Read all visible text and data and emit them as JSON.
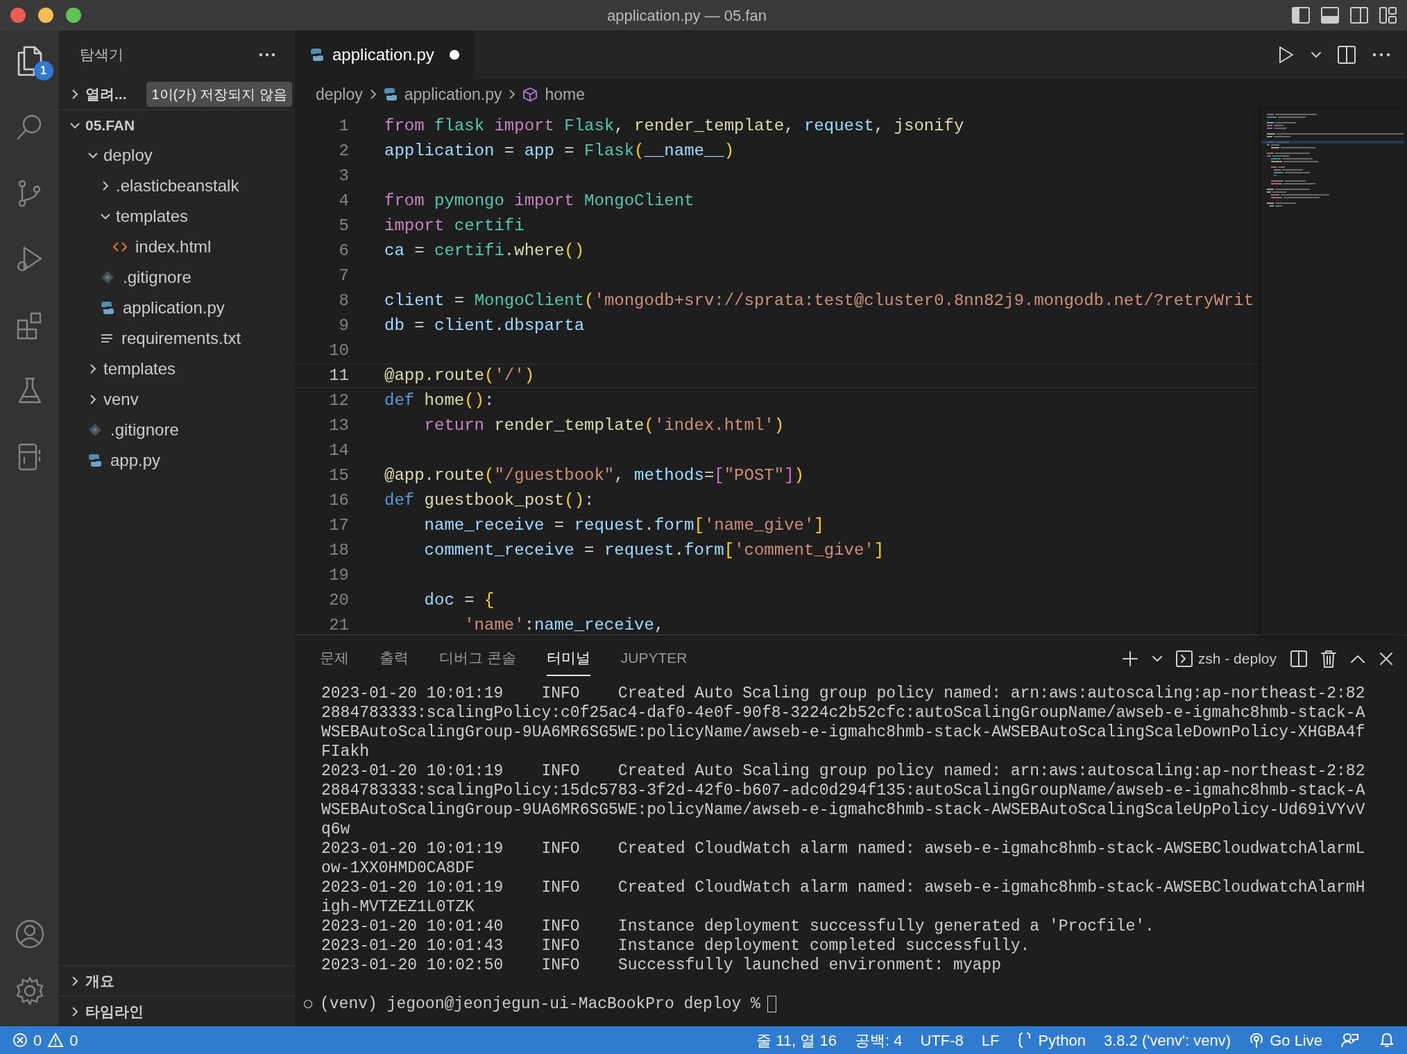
{
  "window": {
    "title": "application.py — 05.fan"
  },
  "activity_bar": {
    "badge": "1"
  },
  "explorer": {
    "title": "탐색기"
  },
  "open_editors": {
    "label": "열려...",
    "expanded": false,
    "badge": "1이(가) 저장되지 않음"
  },
  "folder": {
    "label": "05.FAN",
    "expanded": true,
    "children": [
      {
        "label": "deploy",
        "kind": "folder",
        "expanded": true,
        "children": [
          {
            "label": ".elasticbeanstalk",
            "kind": "folder",
            "expanded": false
          },
          {
            "label": "templates",
            "kind": "folder",
            "expanded": true,
            "children": [
              {
                "label": "index.html",
                "kind": "html"
              }
            ]
          },
          {
            "label": ".gitignore",
            "kind": "git"
          },
          {
            "label": "application.py",
            "kind": "python"
          },
          {
            "label": "requirements.txt",
            "kind": "text"
          }
        ]
      },
      {
        "label": "templates",
        "kind": "folder",
        "expanded": false
      },
      {
        "label": "venv",
        "kind": "folder",
        "expanded": false
      },
      {
        "label": ".gitignore",
        "kind": "git"
      },
      {
        "label": "app.py",
        "kind": "python"
      }
    ]
  },
  "bottom_sections": [
    {
      "label": "개요",
      "expanded": false
    },
    {
      "label": "타임라인",
      "expanded": false
    }
  ],
  "tabs": [
    {
      "label": "application.py",
      "kind": "python",
      "selected": true,
      "modified": true
    }
  ],
  "breadcrumb": [
    {
      "label": "deploy",
      "kind": "folder"
    },
    {
      "label": "application.py",
      "kind": "python"
    },
    {
      "label": "home",
      "kind": "symbol"
    }
  ],
  "code_lines": [
    {
      "number": "1",
      "current": false,
      "tokens": [
        {
          "kind": "kw",
          "text": "from "
        },
        {
          "kind": "cls",
          "text": "flask "
        },
        {
          "kind": "kw",
          "text": "import "
        },
        {
          "kind": "cls",
          "text": "Flask"
        },
        {
          "kind": "plain",
          "text": ", "
        },
        {
          "kind": "fn",
          "text": "render_template"
        },
        {
          "kind": "plain",
          "text": ", "
        },
        {
          "kind": "var",
          "text": "request"
        },
        {
          "kind": "plain",
          "text": ", "
        },
        {
          "kind": "fn",
          "text": "jsonify"
        }
      ]
    },
    {
      "number": "2",
      "current": false,
      "tokens": [
        {
          "kind": "var",
          "text": "application"
        },
        {
          "kind": "plain",
          "text": " = "
        },
        {
          "kind": "var",
          "text": "app"
        },
        {
          "kind": "plain",
          "text": " = "
        },
        {
          "kind": "cls",
          "text": "Flask"
        },
        {
          "kind": "b1",
          "text": "("
        },
        {
          "kind": "var",
          "text": "__name__"
        },
        {
          "kind": "b1",
          "text": ")"
        }
      ]
    },
    {
      "number": "3",
      "current": false
    },
    {
      "number": "4",
      "current": false,
      "tokens": [
        {
          "kind": "kw",
          "text": "from "
        },
        {
          "kind": "cls",
          "text": "pymongo "
        },
        {
          "kind": "kw",
          "text": "import "
        },
        {
          "kind": "cls",
          "text": "MongoClient"
        }
      ]
    },
    {
      "number": "5",
      "current": false,
      "tokens": [
        {
          "kind": "kw",
          "text": "import "
        },
        {
          "kind": "cls",
          "text": "certifi"
        }
      ]
    },
    {
      "number": "6",
      "current": false,
      "tokens": [
        {
          "kind": "var",
          "text": "ca"
        },
        {
          "kind": "plain",
          "text": " = "
        },
        {
          "kind": "cls",
          "text": "certifi"
        },
        {
          "kind": "plain",
          "text": "."
        },
        {
          "kind": "fn",
          "text": "where"
        },
        {
          "kind": "b1",
          "text": "()"
        }
      ]
    },
    {
      "number": "7",
      "current": false
    },
    {
      "number": "8",
      "current": false,
      "tokens": [
        {
          "kind": "var",
          "text": "client"
        },
        {
          "kind": "plain",
          "text": " = "
        },
        {
          "kind": "cls",
          "text": "MongoClient"
        },
        {
          "kind": "b1",
          "text": "("
        },
        {
          "kind": "str",
          "text": "'mongodb+srv://sprata:test@cluster0.8nn82j9.mongodb.net/?retryWrit"
        }
      ]
    },
    {
      "number": "9",
      "current": false,
      "tokens": [
        {
          "kind": "var",
          "text": "db"
        },
        {
          "kind": "plain",
          "text": " = "
        },
        {
          "kind": "var",
          "text": "client"
        },
        {
          "kind": "plain",
          "text": "."
        },
        {
          "kind": "var",
          "text": "dbsparta"
        }
      ]
    },
    {
      "number": "10",
      "current": false
    },
    {
      "number": "11",
      "current": true,
      "tokens": [
        {
          "kind": "fn",
          "text": "@app.route"
        },
        {
          "kind": "b1",
          "text": "("
        },
        {
          "kind": "str",
          "text": "'/'"
        },
        {
          "kind": "b1",
          "text": ")"
        }
      ]
    },
    {
      "number": "12",
      "current": false,
      "tokens": [
        {
          "kind": "def",
          "text": "def "
        },
        {
          "kind": "fn",
          "text": "home"
        },
        {
          "kind": "b1",
          "text": "()"
        },
        {
          "kind": "plain",
          "text": ":"
        }
      ]
    },
    {
      "number": "13",
      "current": false,
      "tokens": [
        {
          "kind": "kw",
          "text": "    return "
        },
        {
          "kind": "fn",
          "text": "render_template"
        },
        {
          "kind": "b1",
          "text": "("
        },
        {
          "kind": "str",
          "text": "'index.html'"
        },
        {
          "kind": "b1",
          "text": ")"
        }
      ]
    },
    {
      "number": "14",
      "current": false
    },
    {
      "number": "15",
      "current": false,
      "tokens": [
        {
          "kind": "fn",
          "text": "@app.route"
        },
        {
          "kind": "b1",
          "text": "("
        },
        {
          "kind": "str",
          "text": "\"/guestbook\""
        },
        {
          "kind": "plain",
          "text": ", "
        },
        {
          "kind": "var",
          "text": "methods"
        },
        {
          "kind": "plain",
          "text": "="
        },
        {
          "kind": "b2",
          "text": "["
        },
        {
          "kind": "str",
          "text": "\"POST\""
        },
        {
          "kind": "b2",
          "text": "]"
        },
        {
          "kind": "b1",
          "text": ")"
        }
      ]
    },
    {
      "number": "16",
      "current": false,
      "tokens": [
        {
          "kind": "def",
          "text": "def "
        },
        {
          "kind": "fn",
          "text": "guestbook_post"
        },
        {
          "kind": "b1",
          "text": "()"
        },
        {
          "kind": "plain",
          "text": ":"
        }
      ]
    },
    {
      "number": "17",
      "current": false,
      "tokens": [
        {
          "kind": "var",
          "text": "    name_receive"
        },
        {
          "kind": "plain",
          "text": " = "
        },
        {
          "kind": "var",
          "text": "request"
        },
        {
          "kind": "plain",
          "text": "."
        },
        {
          "kind": "var",
          "text": "form"
        },
        {
          "kind": "b1",
          "text": "["
        },
        {
          "kind": "str",
          "text": "'name_give'"
        },
        {
          "kind": "b1",
          "text": "]"
        }
      ]
    },
    {
      "number": "18",
      "current": false,
      "tokens": [
        {
          "kind": "var",
          "text": "    comment_receive"
        },
        {
          "kind": "plain",
          "text": " = "
        },
        {
          "kind": "var",
          "text": "request"
        },
        {
          "kind": "plain",
          "text": "."
        },
        {
          "kind": "var",
          "text": "form"
        },
        {
          "kind": "b1",
          "text": "["
        },
        {
          "kind": "str",
          "text": "'comment_give'"
        },
        {
          "kind": "b1",
          "text": "]"
        }
      ]
    },
    {
      "number": "19",
      "current": false
    },
    {
      "number": "20",
      "current": false,
      "tokens": [
        {
          "kind": "var",
          "text": "    doc"
        },
        {
          "kind": "plain",
          "text": " = "
        },
        {
          "kind": "b1",
          "text": "{"
        }
      ]
    },
    {
      "number": "21",
      "current": false,
      "tokens": [
        {
          "kind": "str",
          "text": "        'name'"
        },
        {
          "kind": "plain",
          "text": ":"
        },
        {
          "kind": "var",
          "text": "name_receive"
        },
        {
          "kind": "plain",
          "text": ","
        }
      ]
    }
  ],
  "panel": {
    "tabs": [
      {
        "label": "문제",
        "selected": false
      },
      {
        "label": "출력",
        "selected": false
      },
      {
        "label": "디버그 콘솔",
        "selected": false
      },
      {
        "label": "터미널",
        "selected": true
      },
      {
        "label": "JUPYTER",
        "selected": false
      }
    ],
    "terminal_name": "zsh - deploy",
    "lines": [
      "2023-01-20 10:01:19    INFO    Created Auto Scaling group policy named: arn:aws:autoscaling:ap-northeast-2:82",
      "2884783333:scalingPolicy:c0f25ac4-daf0-4e0f-90f8-3224c2b52cfc:autoScalingGroupName/awseb-e-igmahc8hmb-stack-A",
      "WSEBAutoScalingGroup-9UA6MR6SG5WE:policyName/awseb-e-igmahc8hmb-stack-AWSEBAutoScalingScaleDownPolicy-XHGBA4f",
      "FIakh",
      "2023-01-20 10:01:19    INFO    Created Auto Scaling group policy named: arn:aws:autoscaling:ap-northeast-2:82",
      "2884783333:scalingPolicy:15dc5783-3f2d-42f0-b607-adc0d294f135:autoScalingGroupName/awseb-e-igmahc8hmb-stack-A",
      "WSEBAutoScalingGroup-9UA6MR6SG5WE:policyName/awseb-e-igmahc8hmb-stack-AWSEBAutoScalingScaleUpPolicy-Ud69iVYvV",
      "q6w",
      "2023-01-20 10:01:19    INFO    Created CloudWatch alarm named: awseb-e-igmahc8hmb-stack-AWSEBCloudwatchAlarmL",
      "ow-1XX0HMD0CA8DF",
      "2023-01-20 10:01:19    INFO    Created CloudWatch alarm named: awseb-e-igmahc8hmb-stack-AWSEBCloudwatchAlarmH",
      "igh-MVTZEZ1L0TZK",
      "2023-01-20 10:01:40    INFO    Instance deployment successfully generated a 'Procfile'.",
      "2023-01-20 10:01:43    INFO    Instance deployment completed successfully.",
      "2023-01-20 10:02:50    INFO    Successfully launched environment: myapp"
    ],
    "prompt": "(venv) jegoon@jeonjegun-ui-MacBookPro deploy %"
  },
  "status_bar": {
    "errors": "0",
    "warnings": "0",
    "items": [
      {
        "kind": "text",
        "label": "줄 11, 열 16"
      },
      {
        "kind": "text",
        "label": "공백: 4"
      },
      {
        "kind": "text",
        "label": "UTF-8"
      },
      {
        "kind": "text",
        "label": "LF"
      },
      {
        "kind": "language",
        "label": "Python"
      },
      {
        "kind": "text",
        "label": "3.8.2 ('venv': venv)"
      },
      {
        "kind": "live",
        "label": "Go Live"
      }
    ]
  }
}
